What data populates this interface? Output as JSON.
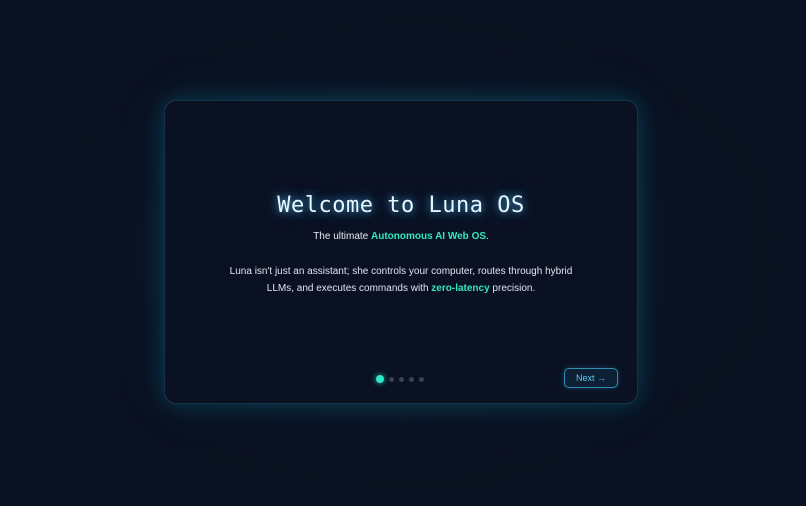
{
  "onboarding": {
    "title": "Welcome to Luna OS",
    "subtitle": {
      "prefix": "The ultimate ",
      "highlight": "Autonomous AI Web OS",
      "suffix": "."
    },
    "description": {
      "prefix": "Luna isn't just an assistant; she controls your computer, routes through hybrid LLMs, and executes commands with ",
      "highlight": "zero-latency",
      "suffix": " precision."
    },
    "pagination": {
      "total_steps": 5,
      "current_step": 1
    },
    "next_label": "Next →"
  },
  "colors": {
    "accent": "#2ee8c6",
    "button": "#5cc8ee",
    "background": "#0a1120"
  }
}
